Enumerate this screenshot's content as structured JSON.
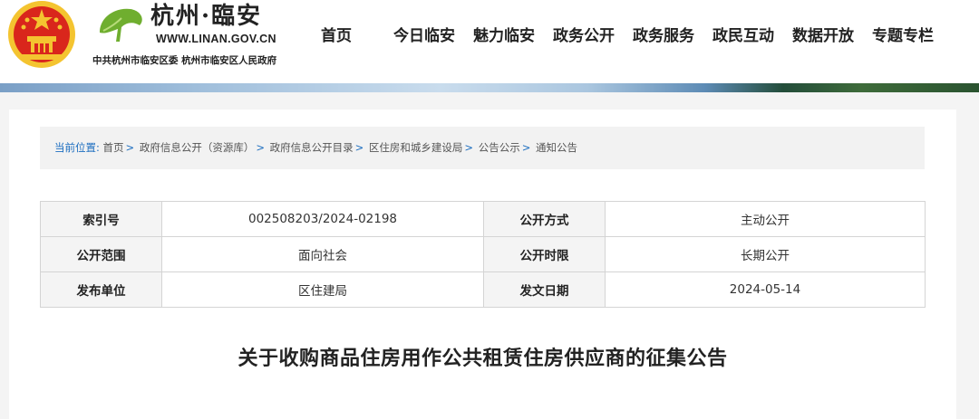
{
  "header": {
    "site_name": "杭州·臨安",
    "site_url": "WWW.LINAN.GOV.CN",
    "org_line": "中共杭州市临安区委  杭州市临安区人民政府"
  },
  "nav": {
    "items": [
      {
        "label": "首页"
      },
      {
        "label": "今日临安"
      },
      {
        "label": "魅力临安"
      },
      {
        "label": "政务公开"
      },
      {
        "label": "政务服务"
      },
      {
        "label": "政民互动"
      },
      {
        "label": "数据开放"
      },
      {
        "label": "专题专栏"
      }
    ]
  },
  "breadcrumb": {
    "lead": "当前位置:",
    "items": [
      {
        "label": "首页"
      },
      {
        "label": "政府信息公开（资源库）"
      },
      {
        "label": "政府信息公开目录"
      },
      {
        "label": "区住房和城乡建设局"
      },
      {
        "label": "公告公示"
      },
      {
        "label": "通知公告"
      }
    ],
    "separator": ">"
  },
  "meta": {
    "rows": [
      {
        "k1": "索引号",
        "v1": "002508203/2024-02198",
        "k2": "公开方式",
        "v2": "主动公开"
      },
      {
        "k1": "公开范围",
        "v1": "面向社会",
        "k2": "公开时限",
        "v2": "长期公开"
      },
      {
        "k1": "发布单位",
        "v1": "区住建局",
        "k2": "发文日期",
        "v2": "2024-05-14"
      }
    ]
  },
  "document": {
    "title": "关于收购商品住房用作公共租赁住房供应商的征集公告"
  },
  "colors": {
    "emblem_red": "#d9261c",
    "emblem_gold": "#f4c430",
    "ginkgo_green": "#6fae2f",
    "breadcrumb_blue": "#1d6ec0"
  }
}
